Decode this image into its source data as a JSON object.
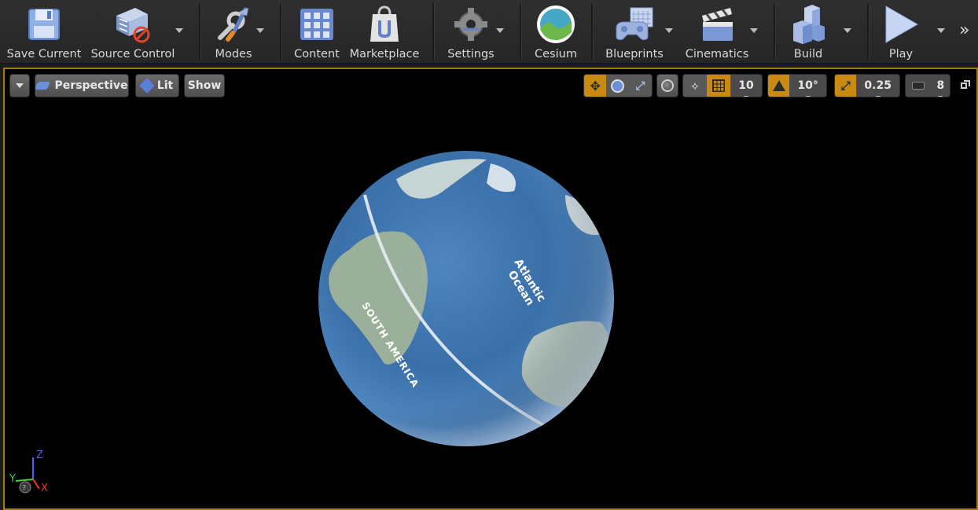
{
  "toolbar": {
    "save_current": "Save Current",
    "source_control": "Source Control",
    "modes": "Modes",
    "content": "Content",
    "marketplace": "Marketplace",
    "settings": "Settings",
    "cesium": "Cesium",
    "blueprints": "Blueprints",
    "cinematics": "Cinematics",
    "build": "Build",
    "play": "Play",
    "more": "»"
  },
  "viewport": {
    "perspective": "Perspective",
    "lit": "Lit",
    "show": "Show",
    "grid_snap": "10",
    "rotation_snap": "10°",
    "scale_snap": "0.25",
    "camera_speed": "8",
    "accent_color": "#c88a12"
  },
  "globe": {
    "ocean_label_line1": "Atlantic",
    "ocean_label_line2": "Ocean",
    "continent_label": "SOUTH AMERICA"
  },
  "axes": {
    "z": "Z",
    "y": "Y",
    "x": "X"
  }
}
